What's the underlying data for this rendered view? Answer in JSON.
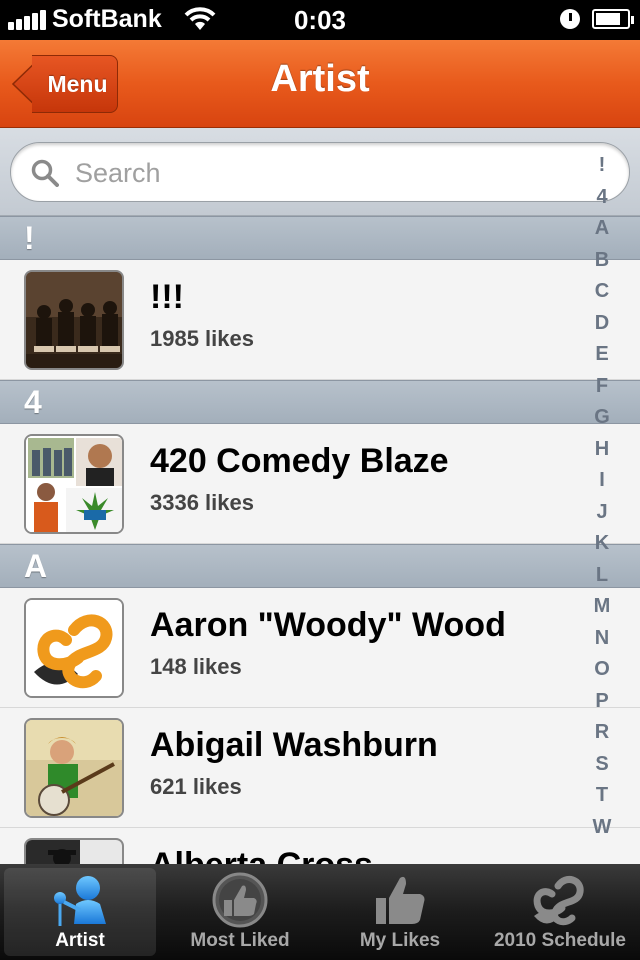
{
  "status_bar": {
    "carrier": "SoftBank",
    "time": "0:03"
  },
  "nav": {
    "title": "Artist",
    "back_label": "Menu"
  },
  "search": {
    "placeholder": "Search"
  },
  "sections": [
    {
      "letter": "!",
      "rows": [
        {
          "title": "!!!",
          "likes": "1985 likes"
        }
      ]
    },
    {
      "letter": "4",
      "rows": [
        {
          "title": "420 Comedy Blaze",
          "likes": "3336 likes"
        }
      ]
    },
    {
      "letter": "A",
      "rows": [
        {
          "title": "Aaron \"Woody\" Wood",
          "likes": "148 likes"
        },
        {
          "title": "Abigail Washburn",
          "likes": "621 likes"
        },
        {
          "title": "Alberta Cross",
          "likes": ""
        }
      ]
    }
  ],
  "index": [
    "!",
    "4",
    "A",
    "B",
    "C",
    "D",
    "E",
    "F",
    "G",
    "H",
    "I",
    "J",
    "K",
    "L",
    "M",
    "N",
    "O",
    "P",
    "R",
    "S",
    "T",
    "W"
  ],
  "tabs": [
    {
      "label": "Artist",
      "icon": "microphone-person-icon",
      "active": true
    },
    {
      "label": "Most Liked",
      "icon": "thumbs-up-circle-icon",
      "active": false
    },
    {
      "label": "My Likes",
      "icon": "thumbs-up-icon",
      "active": false
    },
    {
      "label": "2010 Schedule",
      "icon": "festival-logo-icon",
      "active": false
    }
  ],
  "colors": {
    "nav_orange": "#e85a1c",
    "section_gray": "#a3afbb",
    "index_text": "#6a7584"
  }
}
